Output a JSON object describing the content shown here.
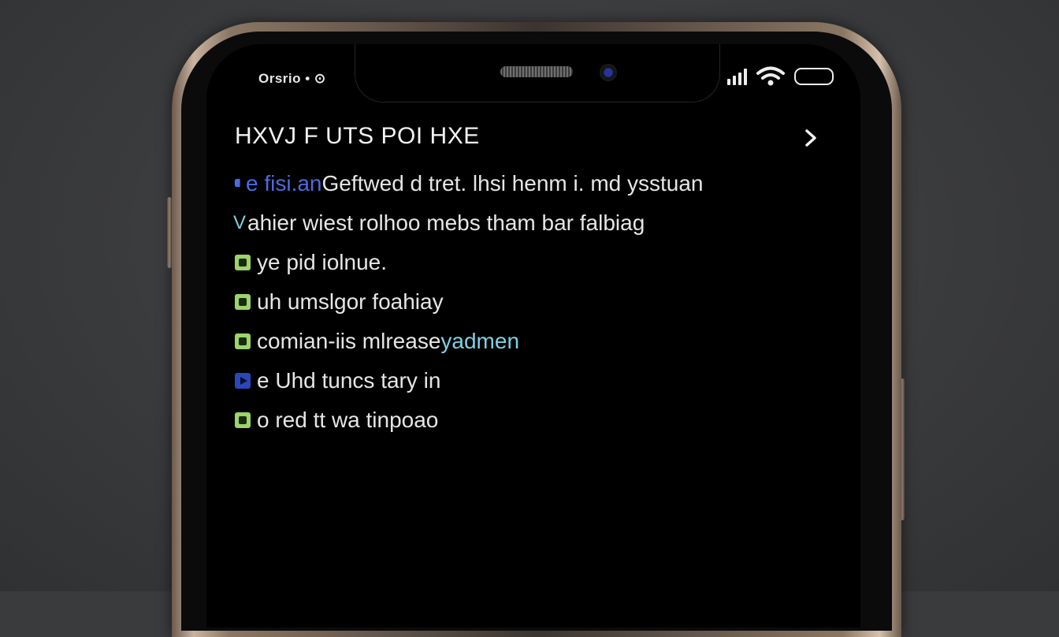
{
  "status_bar": {
    "time": "Orsrio • ⊙",
    "signal_icon": "signal-bars-icon",
    "wifi_icon": "wifi-icon",
    "battery_icon": "battery-icon"
  },
  "header": {
    "title": "HXVJ F UTS POI HXE",
    "chevron_icon": "chevron-right-icon"
  },
  "list": [
    {
      "icon": "blue-bubble-icon",
      "prefix": "e fisi.an",
      "text": " Geftwed d tret. lhsi henm i. md ysstuan",
      "prefix_color": "#4b6be0"
    },
    {
      "icon": "v-check-icon",
      "prefix": "V",
      "text": "ahier wiest  rolhoo mebs tham bar falbiag",
      "prefix_color": "#7fd0e6"
    },
    {
      "icon": "green-square-icon",
      "prefix": "",
      "text": "ye pid iolnue.",
      "prefix_color": "#9cd36c"
    },
    {
      "icon": "green-square-icon",
      "prefix": "",
      "text": " uh umslgor foahiay",
      "prefix_color": "#9cd36c"
    },
    {
      "icon": "green-square-icon",
      "prefix": "",
      "text": " comian-iis mlrease",
      "suffix": "  yadmen",
      "prefix_color": "#9cd36c"
    },
    {
      "icon": "blue-play-icon",
      "prefix": "",
      "text": " e Uhd tuncs tary   in",
      "prefix_color": "#4b6be0"
    },
    {
      "icon": "green-square-icon",
      "prefix": "",
      "text": "o  red tt wa tinpoao",
      "prefix_color": "#9cd36c"
    }
  ],
  "colors": {
    "accent_blue": "#4b6be0",
    "accent_teal": "#7fd0e6",
    "accent_green": "#9cd36c",
    "screen_bg": "#000000",
    "text": "#e6e6e6"
  }
}
